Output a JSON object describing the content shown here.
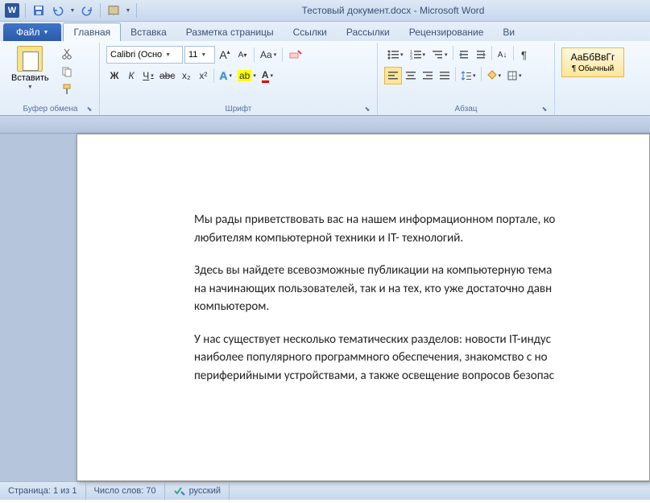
{
  "title": "Тестовый документ.docx - Microsoft Word",
  "word_icon_letter": "W",
  "tabs": {
    "file": "Файл",
    "home": "Главная",
    "insert": "Вставка",
    "layout": "Разметка страницы",
    "references": "Ссылки",
    "mailings": "Рассылки",
    "review": "Рецензирование",
    "view_partial": "Ви"
  },
  "clipboard": {
    "paste": "Вставить",
    "group_label": "Буфер обмена"
  },
  "font": {
    "family": "Calibri (Осно",
    "size": "11",
    "group_label": "Шрифт",
    "grow": "A",
    "shrink": "A",
    "case": "Aa",
    "clear": "⌫",
    "bold": "Ж",
    "italic": "К",
    "underline": "Ч",
    "strike": "abc",
    "sub": "x₂",
    "super": "x²",
    "texteffects": "A",
    "highlight": "ab",
    "fontcolor": "A"
  },
  "paragraph": {
    "group_label": "Абзац"
  },
  "styles": {
    "preview": "АаБбВвГг",
    "name": "¶ Обычный"
  },
  "document": {
    "p1": "Мы рады приветствовать вас на нашем информационном портале, ко",
    "p1b": "любителям компьютерной техники и IT- технологий.",
    "p2": "Здесь вы найдете всевозможные публикации на компьютерную тема",
    "p2b": "на начинающих пользователей, так и на тех, кто уже достаточно давн",
    "p2c": "компьютером.",
    "p3": "У нас существует несколько тематических разделов: новости IT-индус",
    "p3b": "наиболее популярного программного обеспечения, знакомство с но",
    "p3c": "периферийными устройствами, а также освещение вопросов безопас"
  },
  "statusbar": {
    "page": "Страница: 1 из 1",
    "words": "Число слов: 70",
    "language": "русский"
  }
}
